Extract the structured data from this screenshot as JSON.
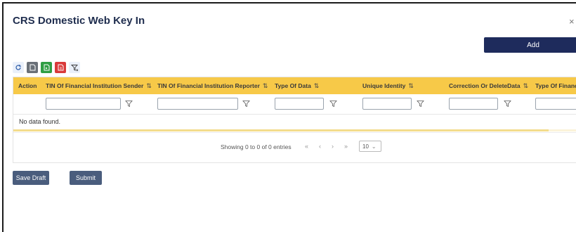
{
  "dialog": {
    "title": "CRS Domestic Web Key In",
    "close_glyph": "×"
  },
  "actions": {
    "add_label": "Add"
  },
  "toolbar": {
    "refresh_icon": "refresh-icon",
    "buttons": [
      "document-icon",
      "excel-icon",
      "pdf-icon",
      "filter-clear-icon"
    ]
  },
  "table": {
    "columns": [
      {
        "label": "Action",
        "sortable": false,
        "filter": false
      },
      {
        "label": "TIN Of Financial Institution Sender",
        "sortable": true,
        "filter": true
      },
      {
        "label": "TIN Of Financial Institution Reporter",
        "sortable": true,
        "filter": true
      },
      {
        "label": "Type Of Data",
        "sortable": true,
        "filter": true
      },
      {
        "label": "Unique Identity",
        "sortable": true,
        "filter": true
      },
      {
        "label": "Correction Or DeleteData",
        "sortable": true,
        "filter": true
      },
      {
        "label": "Type Of Financia",
        "sortable": false,
        "filter": true
      }
    ],
    "sort_glyph": "⇅",
    "empty_message": "No data found."
  },
  "paginator": {
    "report": "Showing 0 to 0 of 0 entries",
    "first": "«",
    "prev": "‹",
    "next": "›",
    "last": "»",
    "rows_per_page": "10",
    "dropdown_glyph": "⌄"
  },
  "footer": {
    "save_draft_label": "Save Draft",
    "submit_label": "Submit"
  },
  "colors": {
    "header_bg": "#f7c948",
    "primary": "#1e2b5c",
    "secondary_button": "#4a5d7d",
    "title": "#1f2d4e"
  }
}
